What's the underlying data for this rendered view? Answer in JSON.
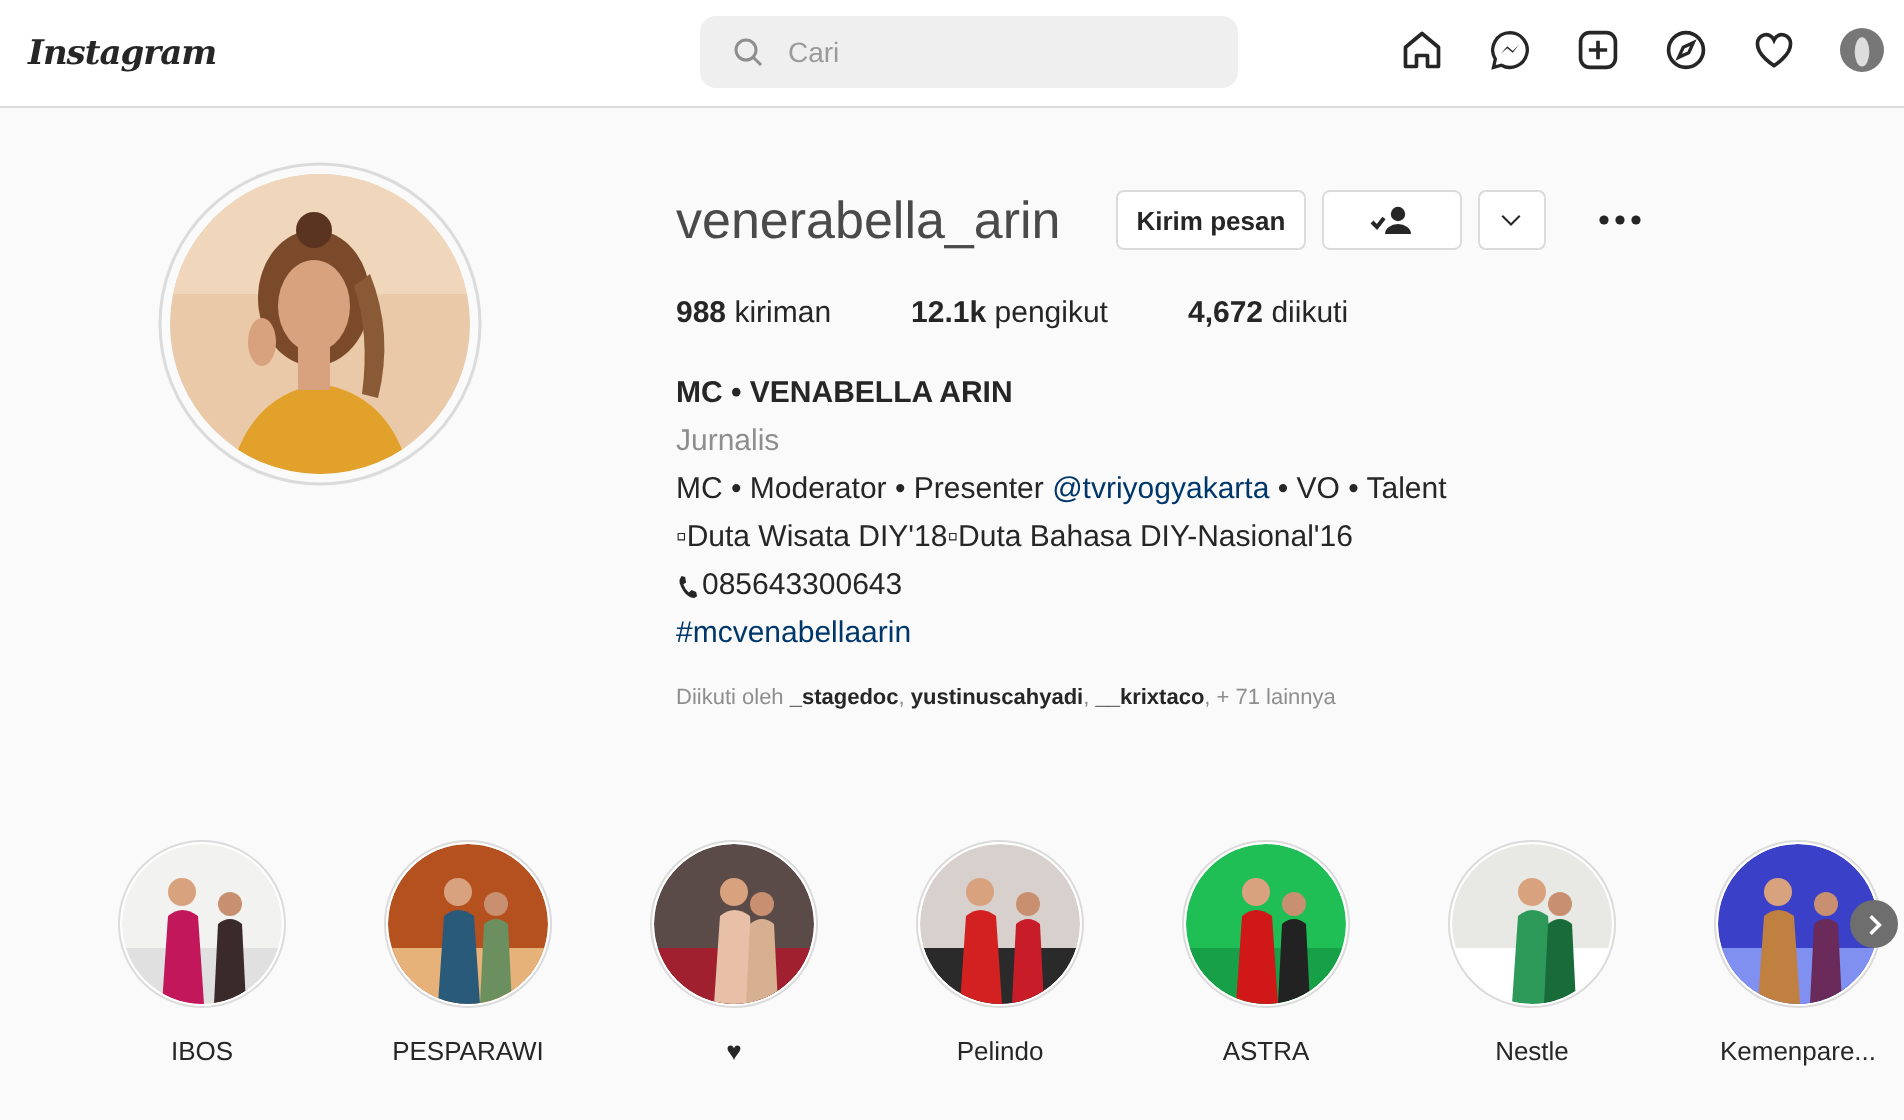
{
  "header": {
    "logo": "Instagram",
    "search": {
      "placeholder": "Cari"
    }
  },
  "profile": {
    "username": "venerabella_arin",
    "buttons": {
      "message": "Kirim pesan"
    },
    "stats": [
      {
        "value": "988",
        "label": "kiriman"
      },
      {
        "value": "12.1k",
        "label": "pengikut"
      },
      {
        "value": "4,672",
        "label": "diikuti"
      }
    ],
    "full_name": "MC • VENABELLA ARIN",
    "category": "Jurnalis",
    "bio_line": {
      "before": "MC • Moderator • Presenter ",
      "link": "@tvriyogyakarta",
      "after": " • VO • Talent"
    },
    "bio_awards": "▫Duta Wisata DIY'18▫Duta Bahasa DIY-Nasional'16",
    "phone": "085643300643",
    "hashtag": "#mcvenabellaarin",
    "followed_by": "Diikuti oleh **_stagedoc**, **yustinuscahyadi**, **__krixtaco**, + 71 lainnya"
  },
  "highlights": [
    {
      "label": "IBOS"
    },
    {
      "label": "PESPARAWI"
    },
    {
      "label": "♥"
    },
    {
      "label": "Pelindo"
    },
    {
      "label": "ASTRA"
    },
    {
      "label": "Nestle"
    },
    {
      "label": "Kemenpare..."
    }
  ]
}
